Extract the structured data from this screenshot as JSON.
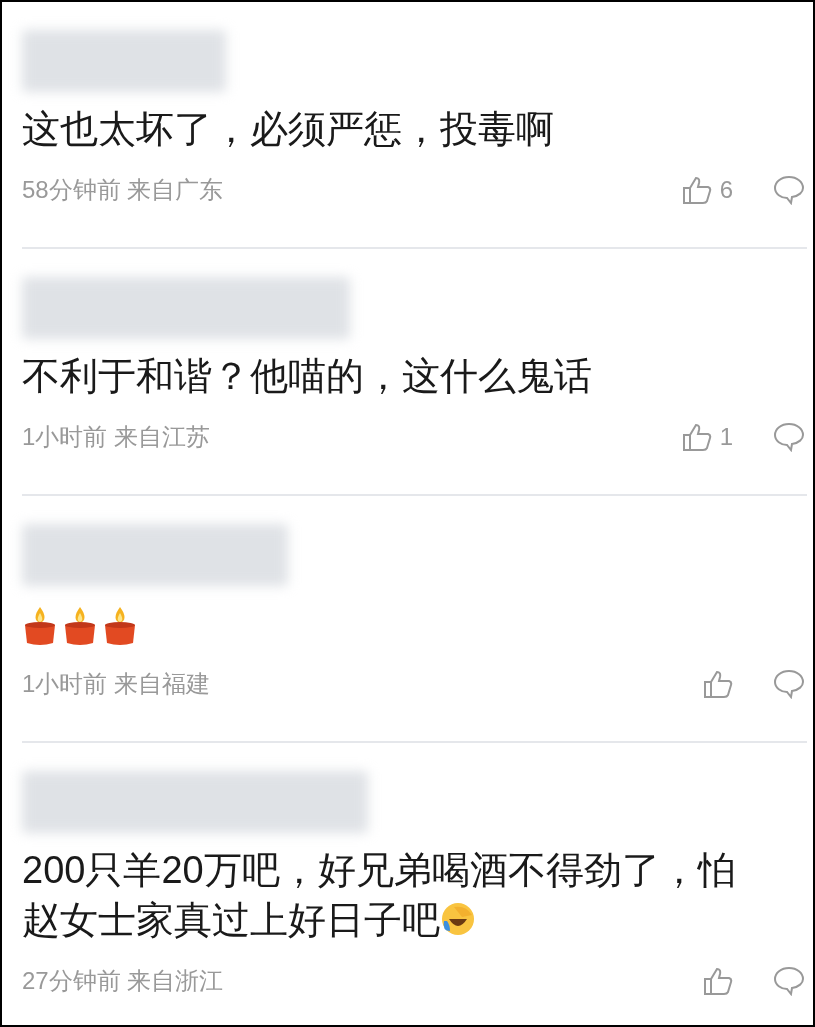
{
  "comments": [
    {
      "name_blurred": true,
      "content": [
        {
          "kind": "text",
          "text": "这也太坏了，必须严惩，投毒啊"
        }
      ],
      "meta": "58分钟前 来自广东",
      "likes": "6"
    },
    {
      "name_blurred": true,
      "content": [
        {
          "kind": "text",
          "text": "不利于和谐？他喵的，这什么鬼话"
        }
      ],
      "meta": "1小时前 来自江苏",
      "likes": "1"
    },
    {
      "name_blurred": true,
      "content": [
        {
          "kind": "candle"
        },
        {
          "kind": "candle"
        },
        {
          "kind": "candle"
        }
      ],
      "meta": "1小时前 来自福建"
    },
    {
      "name_blurred": true,
      "content": [
        {
          "kind": "text",
          "text": "200只羊20万吧，好兄弟喝酒不得劲了，怕赵女士家真过上好日子吧"
        },
        {
          "kind": "laughing"
        }
      ],
      "meta": "27分钟前 来自浙江"
    }
  ]
}
